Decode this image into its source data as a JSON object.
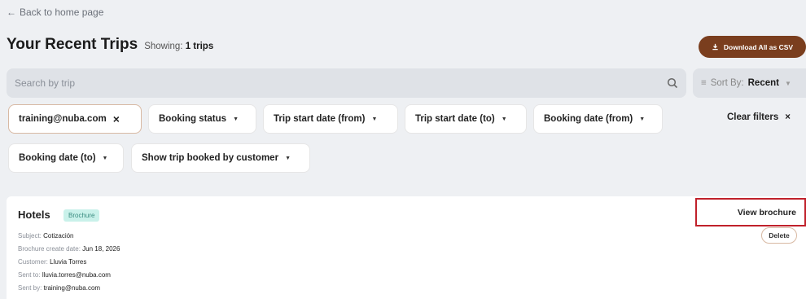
{
  "nav": {
    "back_label": "Back to home page"
  },
  "header": {
    "title": "Your Recent Trips",
    "showing_prefix": "Showing:",
    "showing_value": "1 trips",
    "download_label": "Download All as CSV"
  },
  "search": {
    "placeholder": "Search by trip"
  },
  "sort": {
    "label": "Sort By:",
    "value": "Recent"
  },
  "filters": {
    "email": "training@nuba.com",
    "booking_status": "Booking status",
    "trip_start_from": "Trip start date (from)",
    "trip_start_to": "Trip start date (to)",
    "booking_date_from": "Booking date (from)",
    "booking_date_to": "Booking date (to)",
    "booked_by_customer": "Show trip booked by customer",
    "clear_label": "Clear filters"
  },
  "trip": {
    "title": "Hotels",
    "badge": "Brochure",
    "subject_label": "Subject:",
    "subject_value": "Cotización",
    "created_label": "Brochure create date:",
    "created_value": "Jun 18, 2026",
    "customer_label": "Customer:",
    "customer_value": "Lluvia Torres",
    "sent_to_label": "Sent to:",
    "sent_to_value": "lluvia.torres@nuba.com",
    "sent_by_label": "Sent by:",
    "sent_by_value": "training@nuba.com",
    "view_label": "View brochure",
    "delete_label": "Delete"
  },
  "colors": {
    "accent_brown": "#7a3e1e",
    "badge_bg": "#c9f1ea",
    "highlight_red": "#c0212b"
  }
}
